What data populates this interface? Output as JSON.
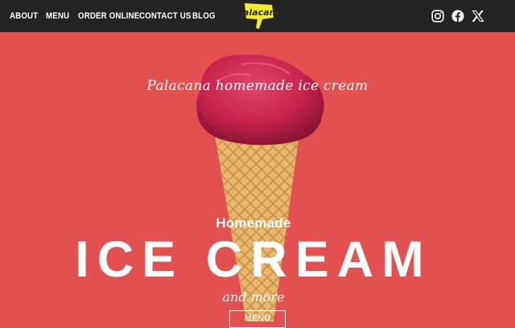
{
  "nav": {
    "items": [
      {
        "label": "ABOUT"
      },
      {
        "label": "MENU"
      },
      {
        "label": "ORDER ONLINE"
      },
      {
        "label": "CONTACT US"
      },
      {
        "label": "BLOG"
      }
    ],
    "logo_text": "palacana",
    "social": [
      "instagram-icon",
      "facebook-icon",
      "x-icon"
    ]
  },
  "hero": {
    "tagline": "Palacana homemade ice cream",
    "homemade": "Homemade",
    "headline": "ICE CREAM",
    "subline": "and more",
    "button": "MENU"
  },
  "colors": {
    "background": "#e2504f",
    "topbar": "#232323",
    "scoop": "#c9234e",
    "cone": "#e8b86f",
    "logo_yellow": "#f2ec2b"
  }
}
